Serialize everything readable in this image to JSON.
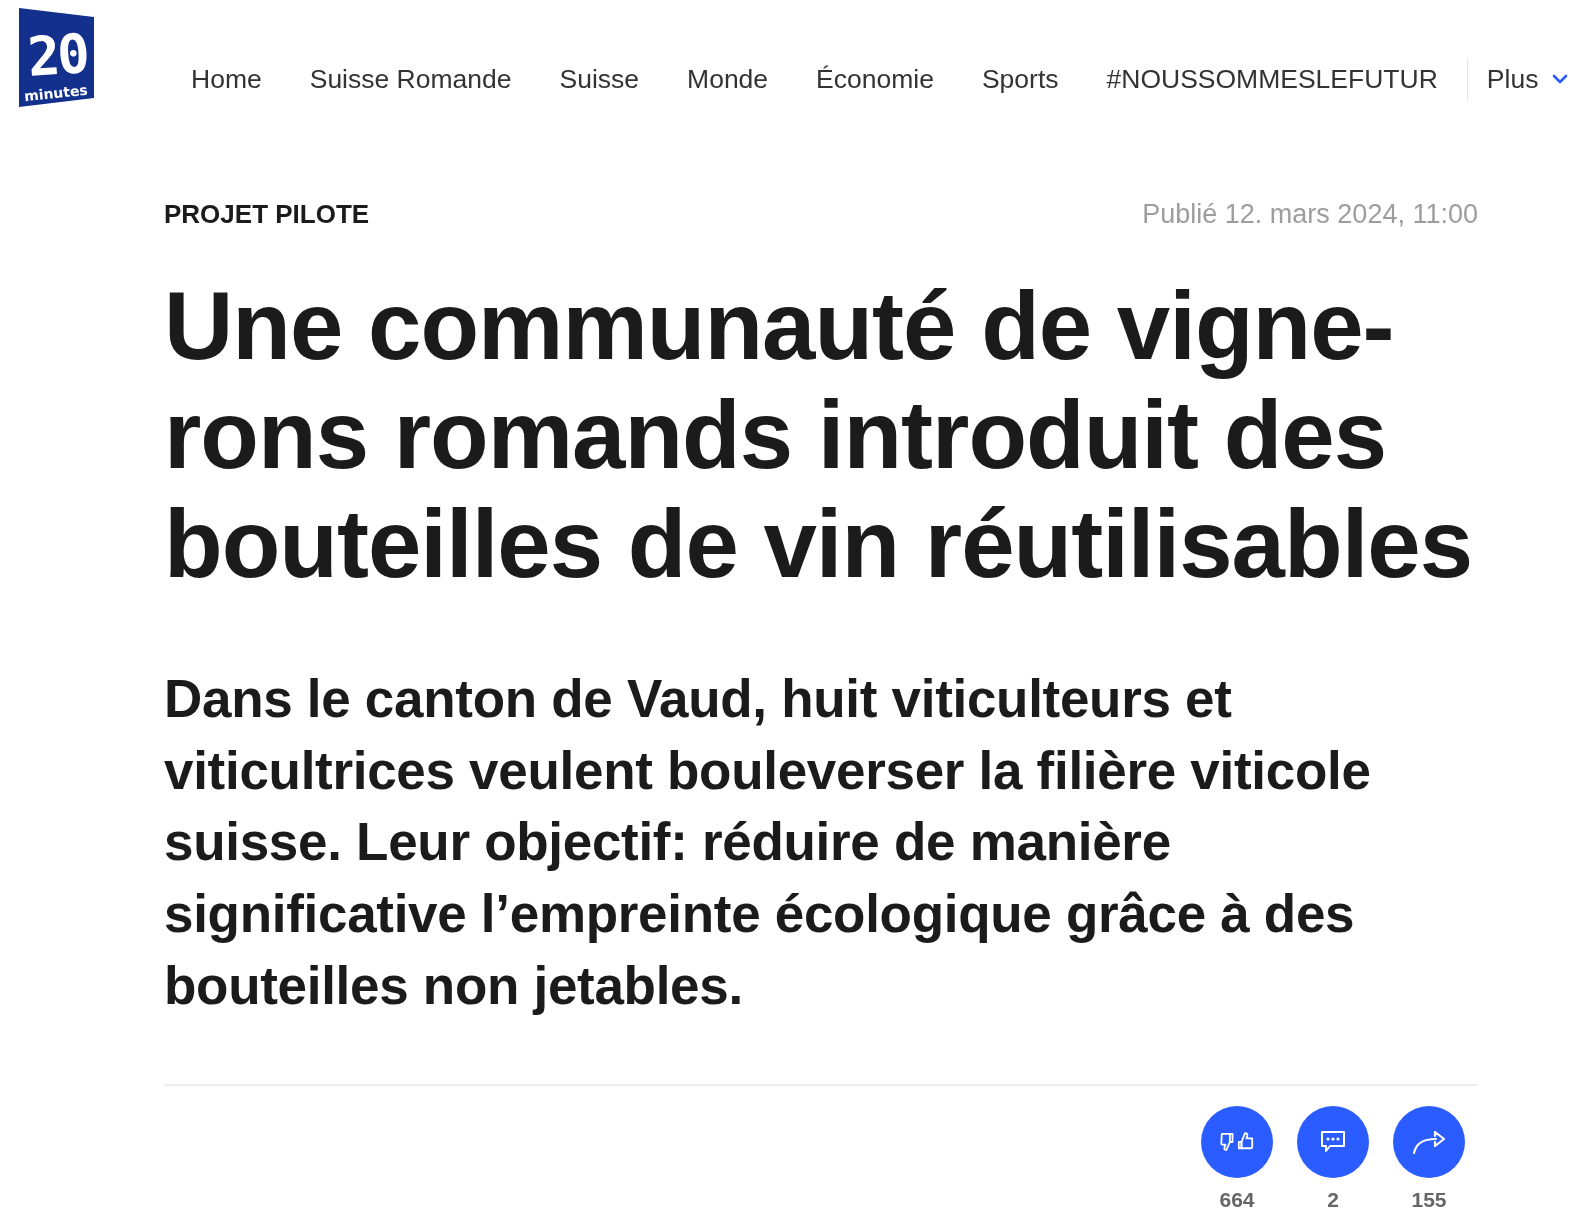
{
  "header": {
    "logo": {
      "digits": "20",
      "word": "minutes"
    },
    "nav": [
      {
        "label": "Home"
      },
      {
        "label": "Suisse Romande"
      },
      {
        "label": "Suisse"
      },
      {
        "label": "Monde"
      },
      {
        "label": "Économie"
      },
      {
        "label": "Sports"
      },
      {
        "label": "#NOUSSOMMESLEFUTUR"
      }
    ],
    "more": {
      "label": "Plus"
    }
  },
  "article": {
    "category": "PROJET PILOTE",
    "published": "Publié 12. mars 2024, 11:00",
    "title": "Une communauté de vigne-rons romands introduit des bouteilles de vin réutilisables",
    "lead": "Dans le canton de Vaud, huit viticulteurs et viticultrices veulent bouleverser la filière viticole suisse. Leur objectif: réduire de manière significative l’empreinte écologique grâce à des bouteilles non jetables.",
    "actions": [
      {
        "kind": "reactions",
        "count": "664"
      },
      {
        "kind": "comments",
        "count": "2"
      },
      {
        "kind": "share",
        "count": "155"
      }
    ]
  }
}
